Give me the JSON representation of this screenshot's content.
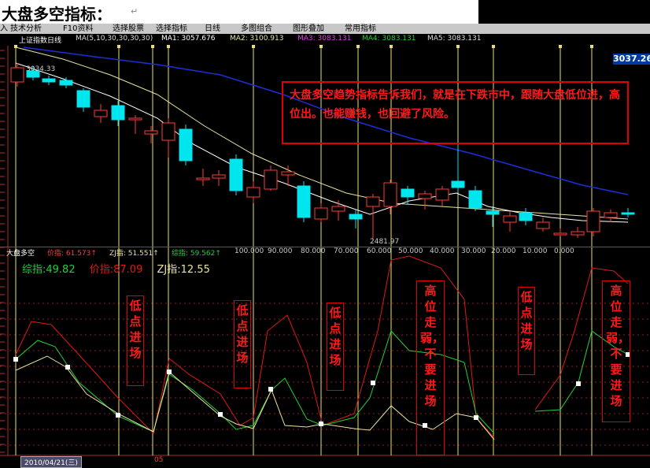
{
  "heading": {
    "title": "大盘多空指标：",
    "mark": "↵"
  },
  "toolbar": {
    "items": [
      "入",
      "技术分析",
      "F10资料",
      "选择股票",
      "选择指标",
      "日线",
      "多图组合",
      "图形叠加",
      "常用指标"
    ]
  },
  "ma_bar": {
    "chart_name": "上证指数日线",
    "params": "MA(5,10,30,30,30,30)",
    "ma1": "MA1: 3057.676",
    "ma2": "MA2: 3100.913",
    "ma3": "MA3: 3083.131",
    "ma4": "MA4: 3083.131",
    "ma5": "MA5: 3083.131"
  },
  "price_box": "3037.26",
  "kline_high_label": "3034.33",
  "kline_low_label": "2481.97",
  "callout": {
    "text": "大盘多空趋势指标告诉我们，就是在下跌市中，跟随大盘低位进，高位出。也能赚钱，也回避了风险。"
  },
  "indicator": {
    "name": "大盘多空",
    "header_vals": [
      "价指: 61.573↑",
      "ZJ指: 51.551↑",
      "综指: 59.562↑",
      "100.000",
      "90.000",
      "80.000",
      "70.000",
      "60.000",
      "50.000",
      "40.000",
      "30.000",
      "20.000",
      "10.000",
      "0.000"
    ],
    "values": [
      {
        "label": "综指:49.82",
        "color": "#1fd13a"
      },
      {
        "label": "价指:87.09",
        "color": "#e01818"
      },
      {
        "label": "ZJ指:12.55",
        "color": "#e8e4a0"
      }
    ]
  },
  "annotations": [
    {
      "text": "低点进场"
    },
    {
      "text": "低点进场"
    },
    {
      "text": "低点进场"
    },
    {
      "text": "高位走弱，不要进场"
    },
    {
      "text": "低点进场"
    },
    {
      "text": "高位走弱，不要进场"
    }
  ],
  "date_bar": {
    "date": "2010/04/21(三)",
    "month": "05"
  },
  "colors": {
    "up": "#ff3b3b",
    "down": "#00e5ee",
    "ma_white": "#ffffff",
    "ma_yellow": "#e8e4a0",
    "ma_blue": "#1c2ed8",
    "accent": "#e00000"
  }
}
